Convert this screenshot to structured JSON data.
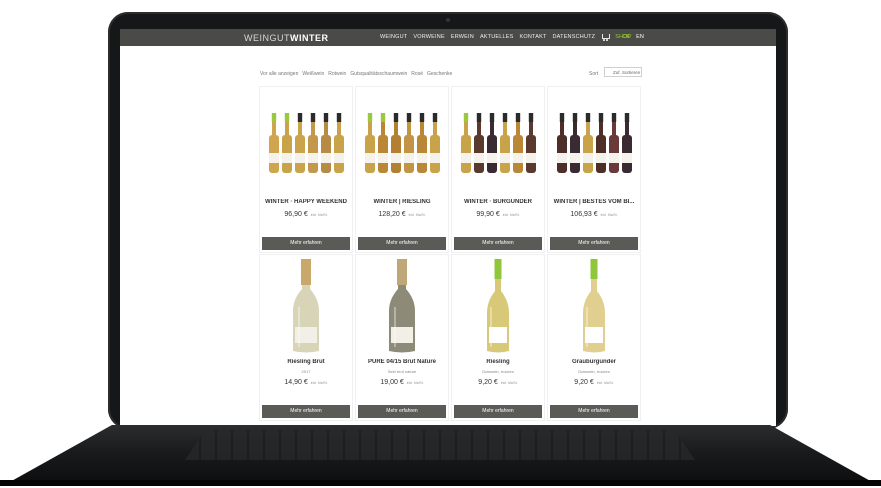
{
  "site": {
    "logo_light": "WEINGUT",
    "logo_bold": "WINTER",
    "nav": [
      "WEINGUT",
      "VORWEINE",
      "ERWEIN",
      "AKTUELLES",
      "KONTAKT",
      "DATENSCHUTZ"
    ],
    "shop_label": "SHOP",
    "lang_de": "DE",
    "lang_en": "EN"
  },
  "breadcrumbs": [
    "Vor alle anzeigen",
    "Weißwein",
    "Rotwein",
    "Gutsqualitätsschaumwein",
    "Rosé",
    "Geschenke"
  ],
  "sort": {
    "label": "Sort",
    "value": "Zuf. Sortieren"
  },
  "more_label": "Mehr erfahren",
  "products": [
    {
      "name": "WINTER · HAPPY WEEKEND",
      "subtitle": "",
      "price": "96,90 €",
      "unit": "inkl. MwSt.",
      "image": "bottle-group",
      "bottles": [
        "#cfa64f",
        "#c9a349",
        "#caa44a",
        "#c3974c",
        "#b58b46",
        "#c9a349"
      ],
      "caps": [
        "#9bc93d",
        "#9bc93d",
        "#2b2b2b",
        "#2b2b2b",
        "#2b2b2b",
        "#2b2b2b"
      ]
    },
    {
      "name": "WINTER | RIESLING",
      "subtitle": "",
      "price": "128,20 €",
      "unit": "inkl. MwSt.",
      "image": "bottle-group",
      "bottles": [
        "#c9a349",
        "#b98736",
        "#b37f32",
        "#c29446",
        "#b98736",
        "#c9a349"
      ],
      "caps": [
        "#9bc93d",
        "#9bc93d",
        "#2b2b2b",
        "#2b2b2b",
        "#2b2b2b",
        "#2b2b2b"
      ]
    },
    {
      "name": "WINTER · BURGUNDER",
      "subtitle": "",
      "price": "99,90 €",
      "unit": "inkl. MwSt.",
      "image": "bottle-group",
      "bottles": [
        "#c9a349",
        "#5a3a2e",
        "#3a2b33",
        "#c9a349",
        "#b98736",
        "#5a3a2e"
      ],
      "caps": [
        "#9bc93d",
        "#2b2b2b",
        "#2b2b2b",
        "#2b2b2b",
        "#2b2b2b",
        "#2b2b2b"
      ]
    },
    {
      "name": "WINTER | BESTES VOM BI...",
      "subtitle": "",
      "price": "106,93 €",
      "unit": "inkl. MwSt.",
      "image": "bottle-group",
      "bottles": [
        "#4d2f28",
        "#3a2b33",
        "#c9a349",
        "#4d2f28",
        "#6a3a3a",
        "#3a2b33"
      ],
      "caps": [
        "#2b2b2b",
        "#2b2b2b",
        "#2b2b2b",
        "#2b2b2b",
        "#2b2b2b",
        "#2b2b2b"
      ]
    },
    {
      "name": "Riesling Brut",
      "subtitle": "2017",
      "price": "14,90 €",
      "unit": "inkl. MwSt.",
      "image": "sparkling",
      "glass": "#d8d4b8",
      "foil": "#c8a86b",
      "label": "#f1efe6"
    },
    {
      "name": "PURE 04/15 Brut Nature",
      "subtitle": "Sekt brut nature",
      "price": "19,00 €",
      "unit": "inkl. MwSt.",
      "image": "sparkling",
      "glass": "#8d8a78",
      "foil": "#bfa778",
      "label": "#f1efe6"
    },
    {
      "name": "Riesling",
      "subtitle": "Gutswein, trocken",
      "price": "9,20 €",
      "unit": "inkl. MwSt.",
      "image": "still",
      "glass": "#d8c978",
      "foil": "#8fc63a",
      "label": "#ffffff"
    },
    {
      "name": "Grauburgunder",
      "subtitle": "Gutswein, trocken",
      "price": "9,20 €",
      "unit": "inkl. MwSt.",
      "image": "still",
      "glass": "#e1cf8f",
      "foil": "#8fc63a",
      "label": "#ffffff"
    }
  ],
  "colors": {
    "header_bg": "#4a4b47",
    "accent": "#9fcf32",
    "button_bg": "#5a5b57"
  }
}
